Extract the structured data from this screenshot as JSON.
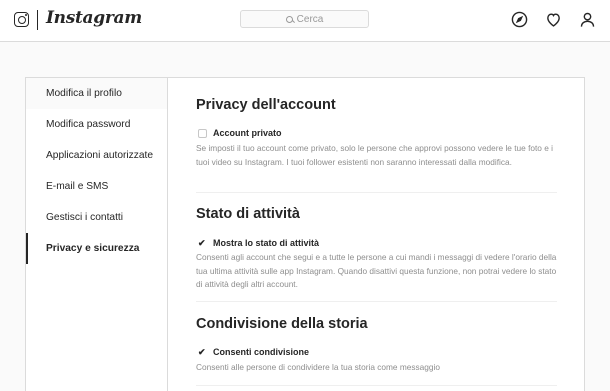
{
  "header": {
    "logo_text": "Instagram",
    "search_placeholder": "Cerca"
  },
  "sidebar": {
    "items": [
      {
        "label": "Modifica il profilo"
      },
      {
        "label": "Modifica password"
      },
      {
        "label": "Applicazioni autorizzate"
      },
      {
        "label": "E-mail e SMS"
      },
      {
        "label": "Gestisci i contatti"
      },
      {
        "label": "Privacy e sicurezza"
      }
    ],
    "active_index": 5
  },
  "sections": {
    "privacy": {
      "title": "Privacy dell'account",
      "option_label": "Account privato",
      "checked": false,
      "description": "Se imposti il tuo account come privato, solo le persone che approvi possono vedere le tue foto e i tuoi video su Instagram. I tuoi follower esistenti non saranno interessati dalla modifica."
    },
    "activity": {
      "title": "Stato di attività",
      "option_label": "Mostra lo stato di attività",
      "checked": true,
      "description": "Consenti agli account che segui e a tutte le persone a cui mandi i messaggi di vedere l'orario della tua ultima attività sulle app Instagram. Quando disattivi questa funzione, non potrai vedere lo stato di attività degli altri account."
    },
    "story": {
      "title": "Condivisione della storia",
      "option_label": "Consenti condivisione",
      "checked": true,
      "description": "Consenti alle persone di condividere la tua storia come messaggio"
    }
  },
  "icons": {
    "logo": "instagram-camera-icon",
    "search": "search-icon",
    "explore": "compass-icon",
    "activity": "heart-icon",
    "profile": "user-icon"
  }
}
